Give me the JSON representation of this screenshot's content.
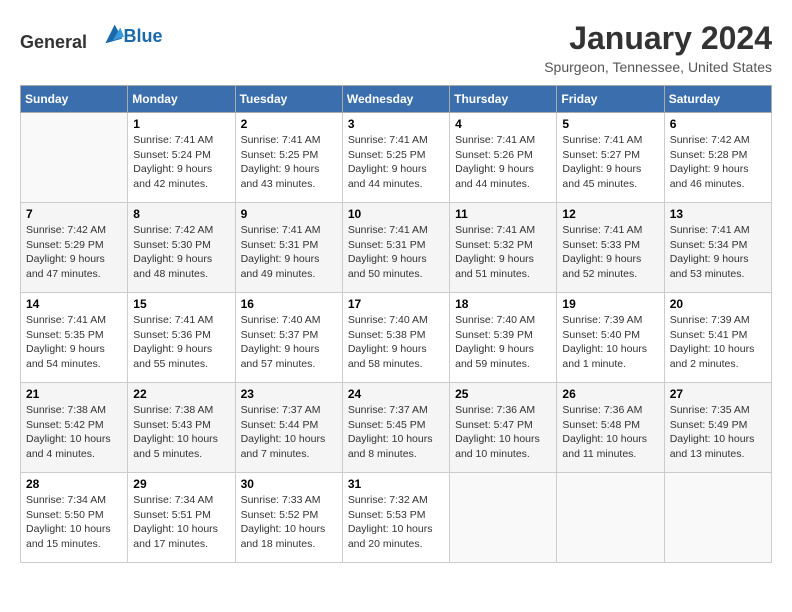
{
  "logo": {
    "general": "General",
    "blue": "Blue"
  },
  "title": "January 2024",
  "location": "Spurgeon, Tennessee, United States",
  "days_of_week": [
    "Sunday",
    "Monday",
    "Tuesday",
    "Wednesday",
    "Thursday",
    "Friday",
    "Saturday"
  ],
  "weeks": [
    [
      {
        "day": "",
        "info": ""
      },
      {
        "day": "1",
        "info": "Sunrise: 7:41 AM\nSunset: 5:24 PM\nDaylight: 9 hours\nand 42 minutes."
      },
      {
        "day": "2",
        "info": "Sunrise: 7:41 AM\nSunset: 5:25 PM\nDaylight: 9 hours\nand 43 minutes."
      },
      {
        "day": "3",
        "info": "Sunrise: 7:41 AM\nSunset: 5:25 PM\nDaylight: 9 hours\nand 44 minutes."
      },
      {
        "day": "4",
        "info": "Sunrise: 7:41 AM\nSunset: 5:26 PM\nDaylight: 9 hours\nand 44 minutes."
      },
      {
        "day": "5",
        "info": "Sunrise: 7:41 AM\nSunset: 5:27 PM\nDaylight: 9 hours\nand 45 minutes."
      },
      {
        "day": "6",
        "info": "Sunrise: 7:42 AM\nSunset: 5:28 PM\nDaylight: 9 hours\nand 46 minutes."
      }
    ],
    [
      {
        "day": "7",
        "info": "Sunrise: 7:42 AM\nSunset: 5:29 PM\nDaylight: 9 hours\nand 47 minutes."
      },
      {
        "day": "8",
        "info": "Sunrise: 7:42 AM\nSunset: 5:30 PM\nDaylight: 9 hours\nand 48 minutes."
      },
      {
        "day": "9",
        "info": "Sunrise: 7:41 AM\nSunset: 5:31 PM\nDaylight: 9 hours\nand 49 minutes."
      },
      {
        "day": "10",
        "info": "Sunrise: 7:41 AM\nSunset: 5:31 PM\nDaylight: 9 hours\nand 50 minutes."
      },
      {
        "day": "11",
        "info": "Sunrise: 7:41 AM\nSunset: 5:32 PM\nDaylight: 9 hours\nand 51 minutes."
      },
      {
        "day": "12",
        "info": "Sunrise: 7:41 AM\nSunset: 5:33 PM\nDaylight: 9 hours\nand 52 minutes."
      },
      {
        "day": "13",
        "info": "Sunrise: 7:41 AM\nSunset: 5:34 PM\nDaylight: 9 hours\nand 53 minutes."
      }
    ],
    [
      {
        "day": "14",
        "info": "Sunrise: 7:41 AM\nSunset: 5:35 PM\nDaylight: 9 hours\nand 54 minutes."
      },
      {
        "day": "15",
        "info": "Sunrise: 7:41 AM\nSunset: 5:36 PM\nDaylight: 9 hours\nand 55 minutes."
      },
      {
        "day": "16",
        "info": "Sunrise: 7:40 AM\nSunset: 5:37 PM\nDaylight: 9 hours\nand 57 minutes."
      },
      {
        "day": "17",
        "info": "Sunrise: 7:40 AM\nSunset: 5:38 PM\nDaylight: 9 hours\nand 58 minutes."
      },
      {
        "day": "18",
        "info": "Sunrise: 7:40 AM\nSunset: 5:39 PM\nDaylight: 9 hours\nand 59 minutes."
      },
      {
        "day": "19",
        "info": "Sunrise: 7:39 AM\nSunset: 5:40 PM\nDaylight: 10 hours\nand 1 minute."
      },
      {
        "day": "20",
        "info": "Sunrise: 7:39 AM\nSunset: 5:41 PM\nDaylight: 10 hours\nand 2 minutes."
      }
    ],
    [
      {
        "day": "21",
        "info": "Sunrise: 7:38 AM\nSunset: 5:42 PM\nDaylight: 10 hours\nand 4 minutes."
      },
      {
        "day": "22",
        "info": "Sunrise: 7:38 AM\nSunset: 5:43 PM\nDaylight: 10 hours\nand 5 minutes."
      },
      {
        "day": "23",
        "info": "Sunrise: 7:37 AM\nSunset: 5:44 PM\nDaylight: 10 hours\nand 7 minutes."
      },
      {
        "day": "24",
        "info": "Sunrise: 7:37 AM\nSunset: 5:45 PM\nDaylight: 10 hours\nand 8 minutes."
      },
      {
        "day": "25",
        "info": "Sunrise: 7:36 AM\nSunset: 5:47 PM\nDaylight: 10 hours\nand 10 minutes."
      },
      {
        "day": "26",
        "info": "Sunrise: 7:36 AM\nSunset: 5:48 PM\nDaylight: 10 hours\nand 11 minutes."
      },
      {
        "day": "27",
        "info": "Sunrise: 7:35 AM\nSunset: 5:49 PM\nDaylight: 10 hours\nand 13 minutes."
      }
    ],
    [
      {
        "day": "28",
        "info": "Sunrise: 7:34 AM\nSunset: 5:50 PM\nDaylight: 10 hours\nand 15 minutes."
      },
      {
        "day": "29",
        "info": "Sunrise: 7:34 AM\nSunset: 5:51 PM\nDaylight: 10 hours\nand 17 minutes."
      },
      {
        "day": "30",
        "info": "Sunrise: 7:33 AM\nSunset: 5:52 PM\nDaylight: 10 hours\nand 18 minutes."
      },
      {
        "day": "31",
        "info": "Sunrise: 7:32 AM\nSunset: 5:53 PM\nDaylight: 10 hours\nand 20 minutes."
      },
      {
        "day": "",
        "info": ""
      },
      {
        "day": "",
        "info": ""
      },
      {
        "day": "",
        "info": ""
      }
    ]
  ]
}
